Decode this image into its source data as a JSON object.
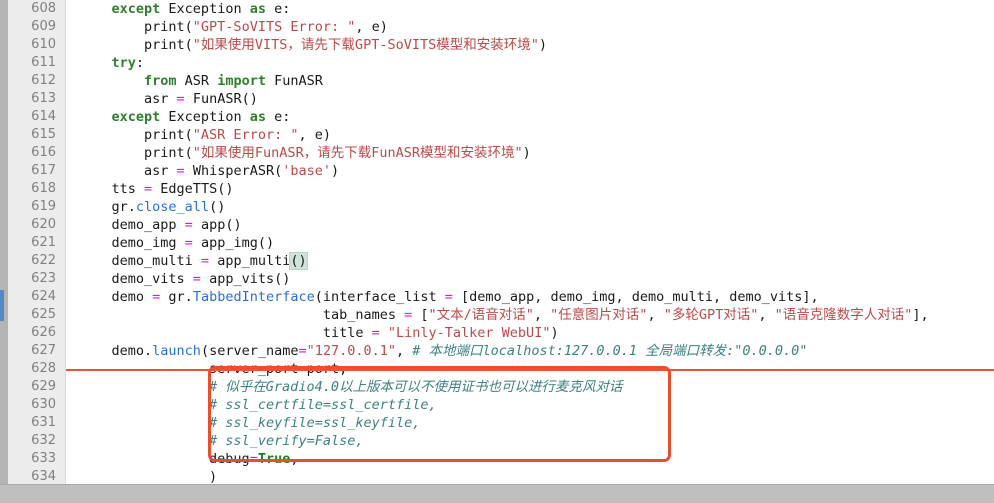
{
  "editor": {
    "first_line": 608,
    "last_line": 634,
    "language": "python",
    "colors": {
      "background": "#ffffff",
      "gutter_background": "#ececec",
      "gutter_text": "#808080",
      "keyword": "#2f7f2f",
      "string": "#ba4a4a",
      "operator": "#cc22cc",
      "function": "#2a6fd6",
      "comment": "#3f8080",
      "annotation_box": "#e8502a",
      "change_marker": "#5588c7",
      "bracket_match": "#cfe3d8"
    }
  },
  "gutter": {
    "line_numbers": [
      "608",
      "609",
      "610",
      "611",
      "612",
      "613",
      "614",
      "615",
      "616",
      "617",
      "618",
      "619",
      "620",
      "621",
      "622",
      "623",
      "624",
      "625",
      "626",
      "627",
      "628",
      "629",
      "630",
      "631",
      "632",
      "633",
      "634"
    ]
  },
  "code": {
    "lines": [
      {
        "n": "608",
        "text": "    except Exception as e:"
      },
      {
        "n": "609",
        "text": "        print(\"GPT-SoVITS Error: \", e)"
      },
      {
        "n": "610",
        "text": "        print(\"如果使用VITS，请先下载GPT-SoVITS模型和安装环境\")"
      },
      {
        "n": "611",
        "text": "    try:"
      },
      {
        "n": "612",
        "text": "        from ASR import FunASR"
      },
      {
        "n": "613",
        "text": "        asr = FunASR()"
      },
      {
        "n": "614",
        "text": "    except Exception as e:"
      },
      {
        "n": "615",
        "text": "        print(\"ASR Error: \", e)"
      },
      {
        "n": "616",
        "text": "        print(\"如果使用FunASR，请先下载FunASR模型和安装环境\")"
      },
      {
        "n": "617",
        "text": "        asr = WhisperASR('base')"
      },
      {
        "n": "618",
        "text": "    tts = EdgeTTS()"
      },
      {
        "n": "619",
        "text": "    gr.close_all()"
      },
      {
        "n": "620",
        "text": "    demo_app = app()"
      },
      {
        "n": "621",
        "text": "    demo_img = app_img()"
      },
      {
        "n": "622",
        "text": "    demo_multi = app_multi()"
      },
      {
        "n": "623",
        "text": "    demo_vits = app_vits()"
      },
      {
        "n": "624",
        "text": "    demo = gr.TabbedInterface(interface_list = [demo_app, demo_img, demo_multi, demo_vits],"
      },
      {
        "n": "625",
        "text": "                              tab_names = [\"文本/语音对话\", \"任意图片对话\", \"多轮GPT对话\", \"语音克隆数字人对话\"],"
      },
      {
        "n": "626",
        "text": "                              title = \"Linly-Talker WebUI\")"
      },
      {
        "n": "627",
        "text": "    demo.launch(server_name=\"127.0.0.1\", # 本地端口localhost:127.0.0.1 全局端口转发:\"0.0.0.0\""
      },
      {
        "n": "628",
        "text": "                server_port=port,"
      },
      {
        "n": "629",
        "text": "                # 似乎在Gradio4.0以上版本可以不使用证书也可以进行麦克风对话"
      },
      {
        "n": "630",
        "text": "                # ssl_certfile=ssl_certfile,"
      },
      {
        "n": "631",
        "text": "                # ssl_keyfile=ssl_keyfile,"
      },
      {
        "n": "632",
        "text": "                # ssl_verify=False,"
      },
      {
        "n": "633",
        "text": "                debug=True,"
      },
      {
        "n": "634",
        "text": "                )"
      }
    ]
  },
  "tokens": {
    "l608": [
      {
        "t": "    ",
        "c": "plain"
      },
      {
        "t": "except",
        "c": "kw"
      },
      {
        "t": " Exception ",
        "c": "plain"
      },
      {
        "t": "as",
        "c": "kw"
      },
      {
        "t": " e:",
        "c": "plain"
      }
    ],
    "l609": [
      {
        "t": "        print(",
        "c": "plain"
      },
      {
        "t": "\"GPT-SoVITS Error: \"",
        "c": "str"
      },
      {
        "t": ", e)",
        "c": "plain"
      }
    ],
    "l610": [
      {
        "t": "        print(",
        "c": "plain"
      },
      {
        "t": "\"如果使用VITS，请先下载GPT-SoVITS模型和安装环境\"",
        "c": "str"
      },
      {
        "t": ")",
        "c": "plain"
      }
    ],
    "l611": [
      {
        "t": "    ",
        "c": "plain"
      },
      {
        "t": "try",
        "c": "kw"
      },
      {
        "t": ":",
        "c": "plain"
      }
    ],
    "l612": [
      {
        "t": "        ",
        "c": "plain"
      },
      {
        "t": "from",
        "c": "kw"
      },
      {
        "t": " ASR ",
        "c": "plain"
      },
      {
        "t": "import",
        "c": "kw"
      },
      {
        "t": " FunASR",
        "c": "plain"
      }
    ],
    "l613": [
      {
        "t": "        asr ",
        "c": "plain"
      },
      {
        "t": "=",
        "c": "op"
      },
      {
        "t": " FunASR()",
        "c": "plain"
      }
    ],
    "l614": [
      {
        "t": "    ",
        "c": "plain"
      },
      {
        "t": "except",
        "c": "kw"
      },
      {
        "t": " Exception ",
        "c": "plain"
      },
      {
        "t": "as",
        "c": "kw"
      },
      {
        "t": " e:",
        "c": "plain"
      }
    ],
    "l615": [
      {
        "t": "        print(",
        "c": "plain"
      },
      {
        "t": "\"ASR Error: \"",
        "c": "str"
      },
      {
        "t": ", e)",
        "c": "plain"
      }
    ],
    "l616": [
      {
        "t": "        print(",
        "c": "plain"
      },
      {
        "t": "\"如果使用FunASR，请先下载FunASR模型和安装环境\"",
        "c": "str"
      },
      {
        "t": ")",
        "c": "plain"
      }
    ],
    "l617": [
      {
        "t": "        asr ",
        "c": "plain"
      },
      {
        "t": "=",
        "c": "op"
      },
      {
        "t": " WhisperASR(",
        "c": "plain"
      },
      {
        "t": "'base'",
        "c": "str"
      },
      {
        "t": ")",
        "c": "plain"
      }
    ],
    "l618": [
      {
        "t": "    tts ",
        "c": "plain"
      },
      {
        "t": "=",
        "c": "op"
      },
      {
        "t": " EdgeTTS()",
        "c": "plain"
      }
    ],
    "l619": [
      {
        "t": "    gr.",
        "c": "plain"
      },
      {
        "t": "close_all",
        "c": "fn"
      },
      {
        "t": "()",
        "c": "plain"
      }
    ],
    "l620": [
      {
        "t": "    demo_app ",
        "c": "plain"
      },
      {
        "t": "=",
        "c": "op"
      },
      {
        "t": " app()",
        "c": "plain"
      }
    ],
    "l621": [
      {
        "t": "    demo_img ",
        "c": "plain"
      },
      {
        "t": "=",
        "c": "op"
      },
      {
        "t": " app_img()",
        "c": "plain"
      }
    ],
    "l622": [
      {
        "t": "    demo_multi ",
        "c": "plain"
      },
      {
        "t": "=",
        "c": "op"
      },
      {
        "t": " app_multi",
        "c": "plain"
      },
      {
        "t": "()",
        "c": "brkmatch"
      }
    ],
    "l623": [
      {
        "t": "    demo_vits ",
        "c": "plain"
      },
      {
        "t": "=",
        "c": "op"
      },
      {
        "t": " app_vits()",
        "c": "plain"
      }
    ],
    "l624": [
      {
        "t": "    demo ",
        "c": "plain"
      },
      {
        "t": "=",
        "c": "op"
      },
      {
        "t": " gr.",
        "c": "plain"
      },
      {
        "t": "TabbedInterface",
        "c": "fn"
      },
      {
        "t": "(interface_list ",
        "c": "plain"
      },
      {
        "t": "=",
        "c": "op"
      },
      {
        "t": " [demo_app, demo_img, demo_multi, demo_vits],",
        "c": "plain"
      }
    ],
    "l625": [
      {
        "t": "                              tab_names ",
        "c": "plain"
      },
      {
        "t": "=",
        "c": "op"
      },
      {
        "t": " [",
        "c": "plain"
      },
      {
        "t": "\"文本/语音对话\"",
        "c": "str"
      },
      {
        "t": ", ",
        "c": "plain"
      },
      {
        "t": "\"任意图片对话\"",
        "c": "str"
      },
      {
        "t": ", ",
        "c": "plain"
      },
      {
        "t": "\"多轮GPT对话\"",
        "c": "str"
      },
      {
        "t": ", ",
        "c": "plain"
      },
      {
        "t": "\"语音克隆数字人对话\"",
        "c": "str"
      },
      {
        "t": "],",
        "c": "plain"
      }
    ],
    "l626": [
      {
        "t": "                              title ",
        "c": "plain"
      },
      {
        "t": "=",
        "c": "op"
      },
      {
        "t": " ",
        "c": "plain"
      },
      {
        "t": "\"Linly-Talker WebUI\"",
        "c": "str"
      },
      {
        "t": ")",
        "c": "plain"
      }
    ],
    "l627": [
      {
        "t": "    demo.",
        "c": "plain"
      },
      {
        "t": "launch",
        "c": "fn"
      },
      {
        "t": "(server_name",
        "c": "plain"
      },
      {
        "t": "=",
        "c": "op"
      },
      {
        "t": "\"127.0.0.1\"",
        "c": "str"
      },
      {
        "t": ", ",
        "c": "plain"
      },
      {
        "t": "# 本地端口localhost:127.0.0.1 全局端口转发:\"0.0.0.0\"",
        "c": "cmt"
      }
    ],
    "l628": [
      {
        "t": "                server_port",
        "c": "plain"
      },
      {
        "t": "=",
        "c": "op"
      },
      {
        "t": "port,",
        "c": "plain"
      }
    ],
    "l629": [
      {
        "t": "                ",
        "c": "plain"
      },
      {
        "t": "# 似乎在Gradio4.0以上版本可以不使用证书也可以进行麦克风对话",
        "c": "cmt"
      }
    ],
    "l630": [
      {
        "t": "                ",
        "c": "plain"
      },
      {
        "t": "# ssl_certfile=ssl_certfile,",
        "c": "cmt"
      }
    ],
    "l631": [
      {
        "t": "                ",
        "c": "plain"
      },
      {
        "t": "# ssl_keyfile=ssl_keyfile,",
        "c": "cmt"
      }
    ],
    "l632": [
      {
        "t": "                ",
        "c": "plain"
      },
      {
        "t": "# ssl_verify=False,",
        "c": "cmt"
      }
    ],
    "l633": [
      {
        "t": "                debug",
        "c": "plain"
      },
      {
        "t": "=",
        "c": "op"
      },
      {
        "t": "True",
        "c": "bool"
      },
      {
        "t": ",",
        "c": "plain"
      }
    ],
    "l634": [
      {
        "t": "                )",
        "c": "plain"
      }
    ]
  },
  "annotation": {
    "shape": "rectangle",
    "color": "#e8502a",
    "covers_lines": [
      "628",
      "629",
      "630",
      "631",
      "632",
      "633"
    ]
  }
}
